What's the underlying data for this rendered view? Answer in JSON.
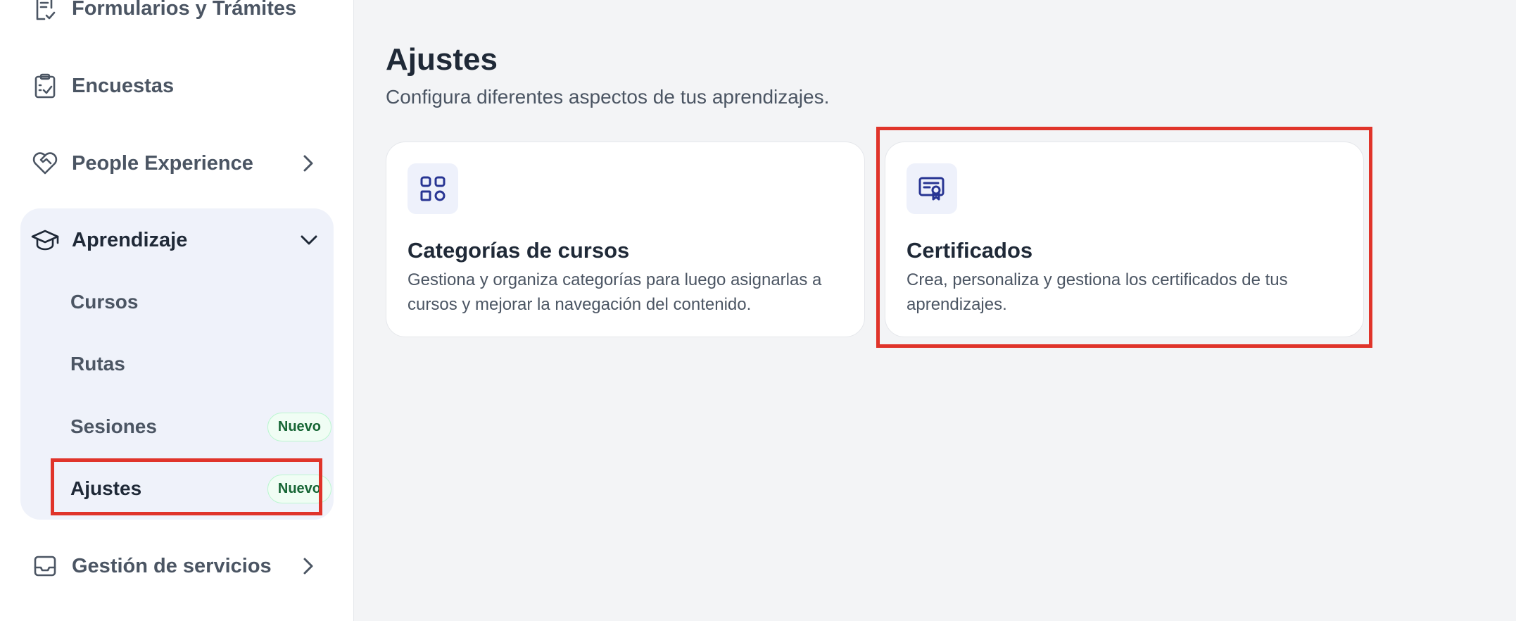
{
  "sidebar": {
    "items": [
      {
        "label": "Formularios y Trámites",
        "icon": "form-checklist-icon"
      },
      {
        "label": "Encuestas",
        "icon": "clipboard-check-icon"
      },
      {
        "label": "People Experience",
        "icon": "heart-handshake-icon"
      }
    ],
    "group": {
      "label": "Aprendizaje",
      "icon": "graduation-cap-icon",
      "subitems": [
        {
          "label": "Cursos"
        },
        {
          "label": "Rutas"
        },
        {
          "label": "Sesiones",
          "badge": "Nuevo"
        },
        {
          "label": "Ajustes",
          "badge": "Nuevo"
        }
      ]
    },
    "bottom_item": {
      "label": "Gestión de servicios",
      "icon": "inbox-icon"
    }
  },
  "main": {
    "title": "Ajustes",
    "subtitle": "Configura diferentes aspectos de tus aprendizajes.",
    "cards": [
      {
        "title": "Categorías de cursos",
        "description": "Gestiona y organiza categorías para luego asignarlas a cursos y mejorar la navegación del contenido.",
        "icon": "categories-icon"
      },
      {
        "title": "Certificados",
        "description": "Crea, personaliza y gestiona los certificados de tus aprendizajes.",
        "icon": "certificate-icon"
      }
    ]
  },
  "colors": {
    "highlight": "#e0342a",
    "icon_accent": "#283593",
    "badge_text": "#166534",
    "group_bg": "#eff2fa"
  }
}
